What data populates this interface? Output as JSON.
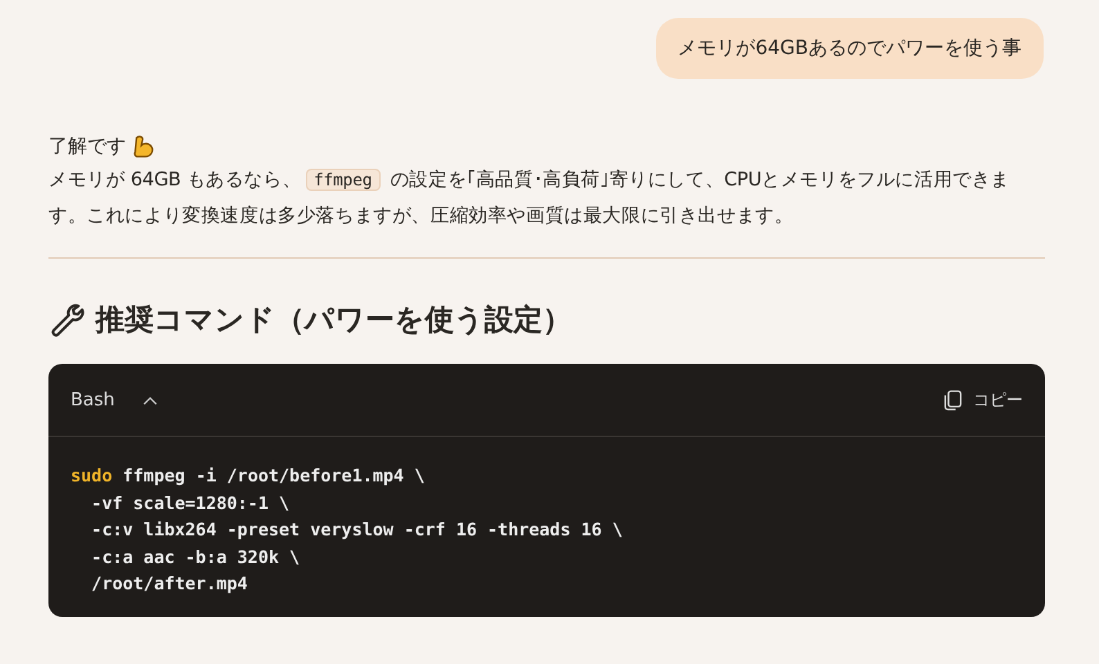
{
  "user_message": "メモリが64GBあるのでパワーを使う事",
  "reply": {
    "greeting": "了解です",
    "paragraph": [
      {
        "kind": "text",
        "text": "メモリが 64GB もあるなら、"
      },
      {
        "kind": "code",
        "text": "ffmpeg"
      },
      {
        "kind": "text",
        "text": " の設定を｢高品質･高負荷｣寄りにして、CPUとメモリをフルに活用できます。これにより変換速度は多少落ちますが、圧縮効率や画質は最大限に引き出せます。"
      }
    ],
    "heading": "推奨コマンド（パワーを使う設定）",
    "code_block": {
      "language": "Bash",
      "expanded": true,
      "copy_label": "コピー",
      "lines": [
        [
          {
            "kind": "keyword",
            "text": "sudo"
          },
          {
            "kind": "plain",
            "text": " ffmpeg -i /root/before1.mp4 \\"
          }
        ],
        [
          {
            "kind": "plain",
            "text": "  -vf scale=1280:-1 \\"
          }
        ],
        [
          {
            "kind": "plain",
            "text": "  -c:v libx264 -preset veryslow -crf 16 -threads 16 \\"
          }
        ],
        [
          {
            "kind": "plain",
            "text": "  -c:a aac -b:a 320k \\"
          }
        ],
        [
          {
            "kind": "plain",
            "text": "  /root/after.mp4"
          }
        ]
      ]
    }
  }
}
